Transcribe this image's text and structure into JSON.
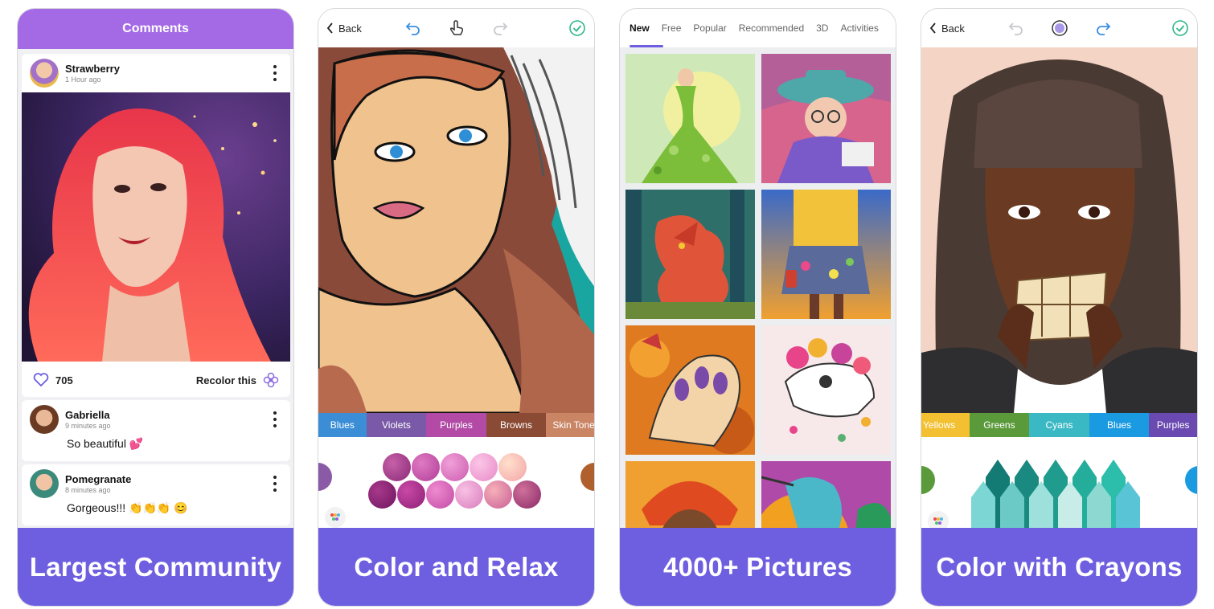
{
  "panels": {
    "community": {
      "header_title": "Comments",
      "post": {
        "username": "Strawberry",
        "time": "1 Hour ago",
        "likes": "705",
        "recolor_label": "Recolor this"
      },
      "comments": [
        {
          "username": "Gabriella",
          "time": "9 minutes ago",
          "text": "So beautiful 💕"
        },
        {
          "username": "Pomegranate",
          "time": "8 minutes ago",
          "text": "Gorgeous!!! 👏👏👏 😊"
        }
      ],
      "caption": "Largest Community"
    },
    "relax": {
      "back_label": "Back",
      "color_tabs": [
        "Blues",
        "Violets",
        "Purples",
        "Browns",
        "Skin Tone"
      ],
      "caption": "Color and Relax"
    },
    "pictures": {
      "tabs": [
        "New",
        "Free",
        "Popular",
        "Recommended",
        "3D",
        "Activities"
      ],
      "active_tab": "New",
      "caption": "4000+ Pictures"
    },
    "crayons": {
      "back_label": "Back",
      "color_tabs": [
        "Yellows",
        "Greens",
        "Cyans",
        "Blues",
        "Purples"
      ],
      "caption": "Color with Crayons"
    }
  },
  "colors": {
    "brand_purple": "#6e5ee0",
    "header_purple": "#a46ae6",
    "check_green": "#2fb887",
    "undo_blue": "#3a8fe0"
  }
}
